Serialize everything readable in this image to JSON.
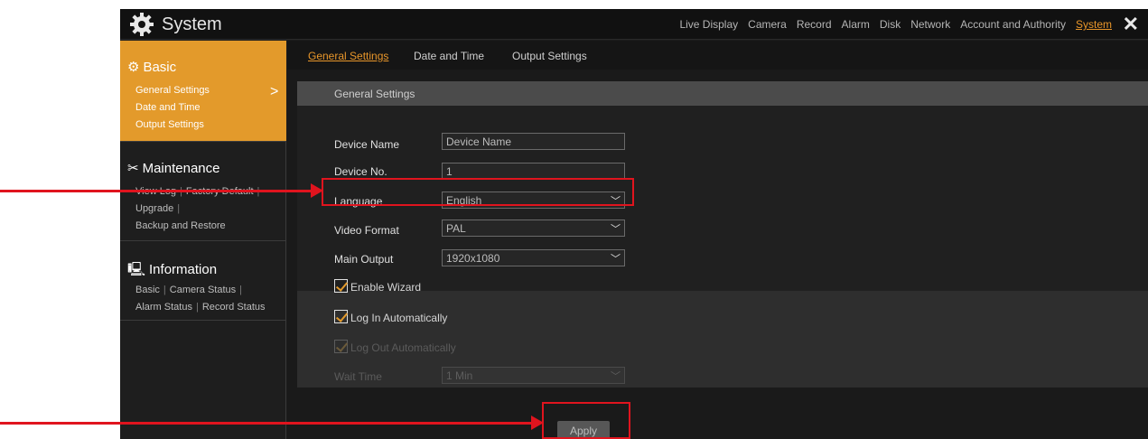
{
  "app": {
    "title": "System",
    "close_glyph": "✕"
  },
  "top_nav": [
    "Live Display",
    "Camera",
    "Record",
    "Alarm",
    "Disk",
    "Network",
    "Account and Authority",
    "System"
  ],
  "top_nav_active": "System",
  "sidebar": {
    "basic": {
      "title": "Basic",
      "items": [
        "General Settings",
        "Date and Time",
        "Output Settings"
      ]
    },
    "maintenance": {
      "title": "Maintenance",
      "items": [
        "View Log",
        "Factory Default",
        "Upgrade",
        "Backup and Restore"
      ]
    },
    "information": {
      "title": "Information",
      "items": [
        "Basic",
        "Camera Status",
        "Alarm Status",
        "Record Status"
      ]
    }
  },
  "tabs": [
    "General Settings",
    "Date and Time",
    "Output Settings"
  ],
  "panel_header": "General Settings",
  "form": {
    "device_name": {
      "label": "Device Name",
      "value": "Device Name"
    },
    "device_no": {
      "label": "Device No.",
      "value": "1"
    },
    "language": {
      "label": "Language",
      "value": "English"
    },
    "video_format": {
      "label": "Video Format",
      "value": "PAL"
    },
    "main_output": {
      "label": "Main Output",
      "value": "1920x1080"
    },
    "enable_wizard": {
      "label": "Enable Wizard",
      "checked": true
    },
    "log_in_auto": {
      "label": "Log In Automatically",
      "checked": true
    },
    "log_out_auto": {
      "label": "Log Out Automatically",
      "checked": true,
      "disabled": true
    },
    "wait_time": {
      "label": "Wait Time",
      "value": "1 Min",
      "disabled": true
    }
  },
  "apply_label": "Apply",
  "colors": {
    "accent": "#e39a2b",
    "annotation": "#e0141e"
  }
}
